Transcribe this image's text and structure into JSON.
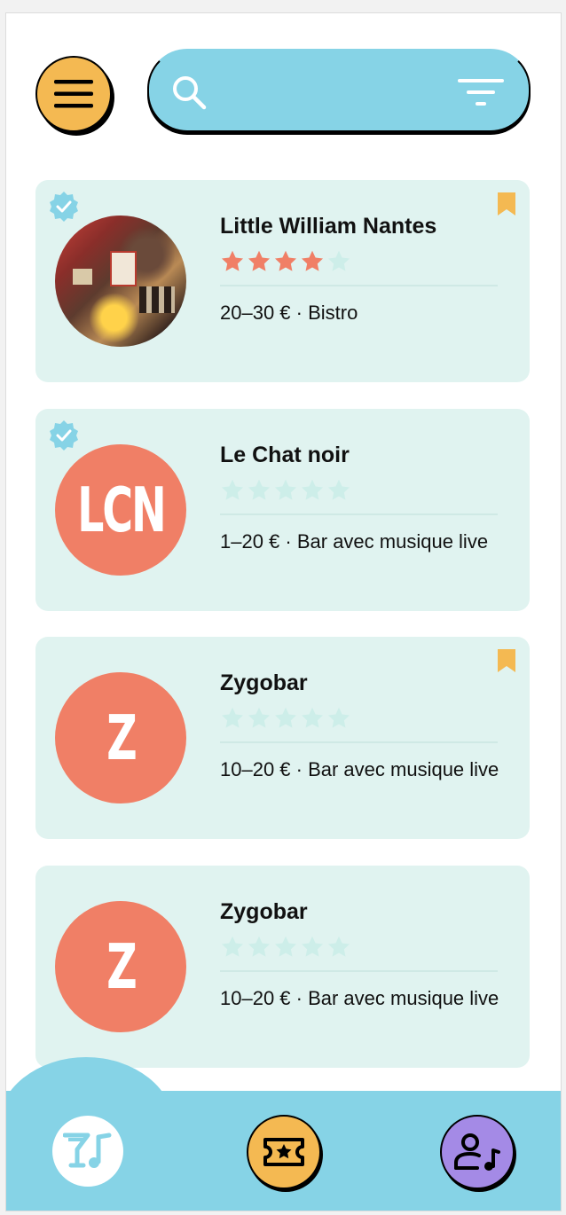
{
  "header": {
    "menu_icon": "hamburger-menu-icon",
    "search_icon": "search-icon",
    "filter_icon": "filter-icon",
    "search_value": "",
    "search_placeholder": ""
  },
  "colors": {
    "accent_blue": "#86d3e6",
    "accent_yellow": "#f4b952",
    "accent_coral": "#f07f66",
    "accent_purple": "#a48ae6",
    "card_bg": "#e0f3f0",
    "star_filled": "#f07f66",
    "star_empty": "#cdeee9"
  },
  "venues": [
    {
      "name": "Little William Nantes",
      "meta": "20–30 € · Bistro",
      "rating": 4,
      "max_rating": 5,
      "verified": true,
      "bookmarked": true,
      "avatar": {
        "type": "photo",
        "initials": ""
      }
    },
    {
      "name": "Le Chat noir",
      "meta": "1–20 € · Bar avec musique live",
      "rating": 0,
      "max_rating": 5,
      "verified": true,
      "bookmarked": false,
      "avatar": {
        "type": "initials",
        "initials": "LCN"
      }
    },
    {
      "name": "Zygobar",
      "meta": "10–20 € · Bar avec musique live",
      "rating": 0,
      "max_rating": 5,
      "verified": false,
      "bookmarked": true,
      "avatar": {
        "type": "initials",
        "initials": "Z"
      }
    },
    {
      "name": "Zygobar",
      "meta": "10–20 € · Bar avec musique live",
      "rating": 0,
      "max_rating": 5,
      "verified": false,
      "bookmarked": false,
      "avatar": {
        "type": "initials",
        "initials": "Z"
      }
    }
  ],
  "bottom_nav": [
    {
      "id": "drinks",
      "icon": "cocktail-music-icon",
      "active": true
    },
    {
      "id": "tickets",
      "icon": "ticket-star-icon",
      "active": false
    },
    {
      "id": "profile",
      "icon": "user-music-icon",
      "active": false
    }
  ]
}
